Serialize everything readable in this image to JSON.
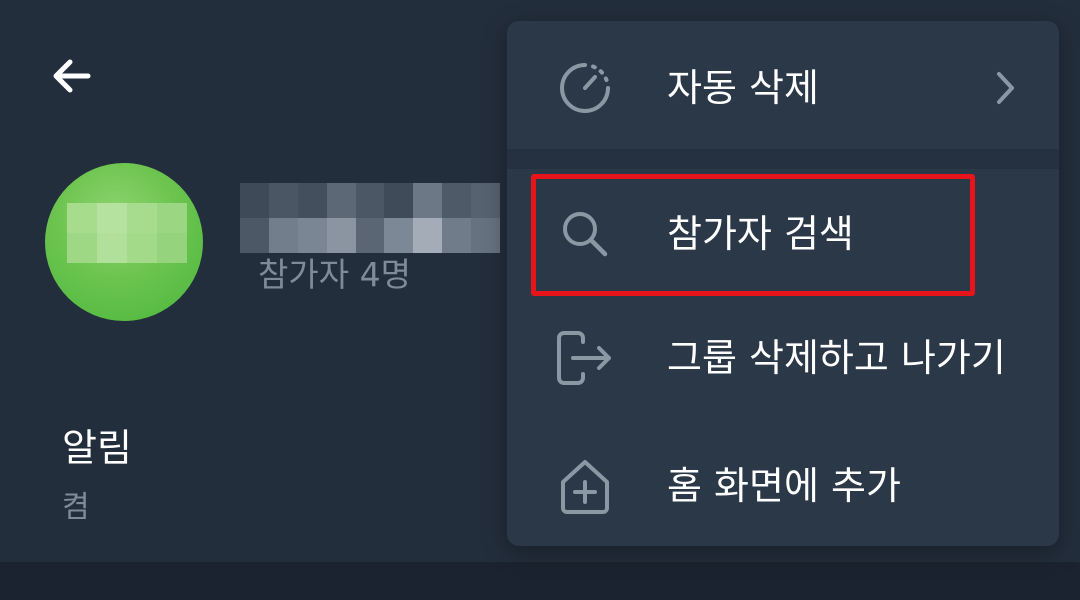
{
  "header": {
    "back_icon": "arrow-left-icon",
    "member_count": "참가자 4명"
  },
  "settings": {
    "notifications_title": "알림",
    "notifications_value": "켬"
  },
  "menu": {
    "items": [
      {
        "label": "자동 삭제",
        "icon": "timer-icon",
        "has_submenu": true
      },
      {
        "label": "참가자 검색",
        "icon": "search-icon",
        "highlighted": true
      },
      {
        "label": "그룹 삭제하고 나가기",
        "icon": "exit-icon"
      },
      {
        "label": "홈 화면에 추가",
        "icon": "add-home-icon"
      }
    ]
  },
  "colors": {
    "background": "#232e3c",
    "menu_background": "#2b3848",
    "secondary_text": "#7f8b98",
    "highlight": "#e8141b",
    "avatar": "#6cc44f"
  }
}
